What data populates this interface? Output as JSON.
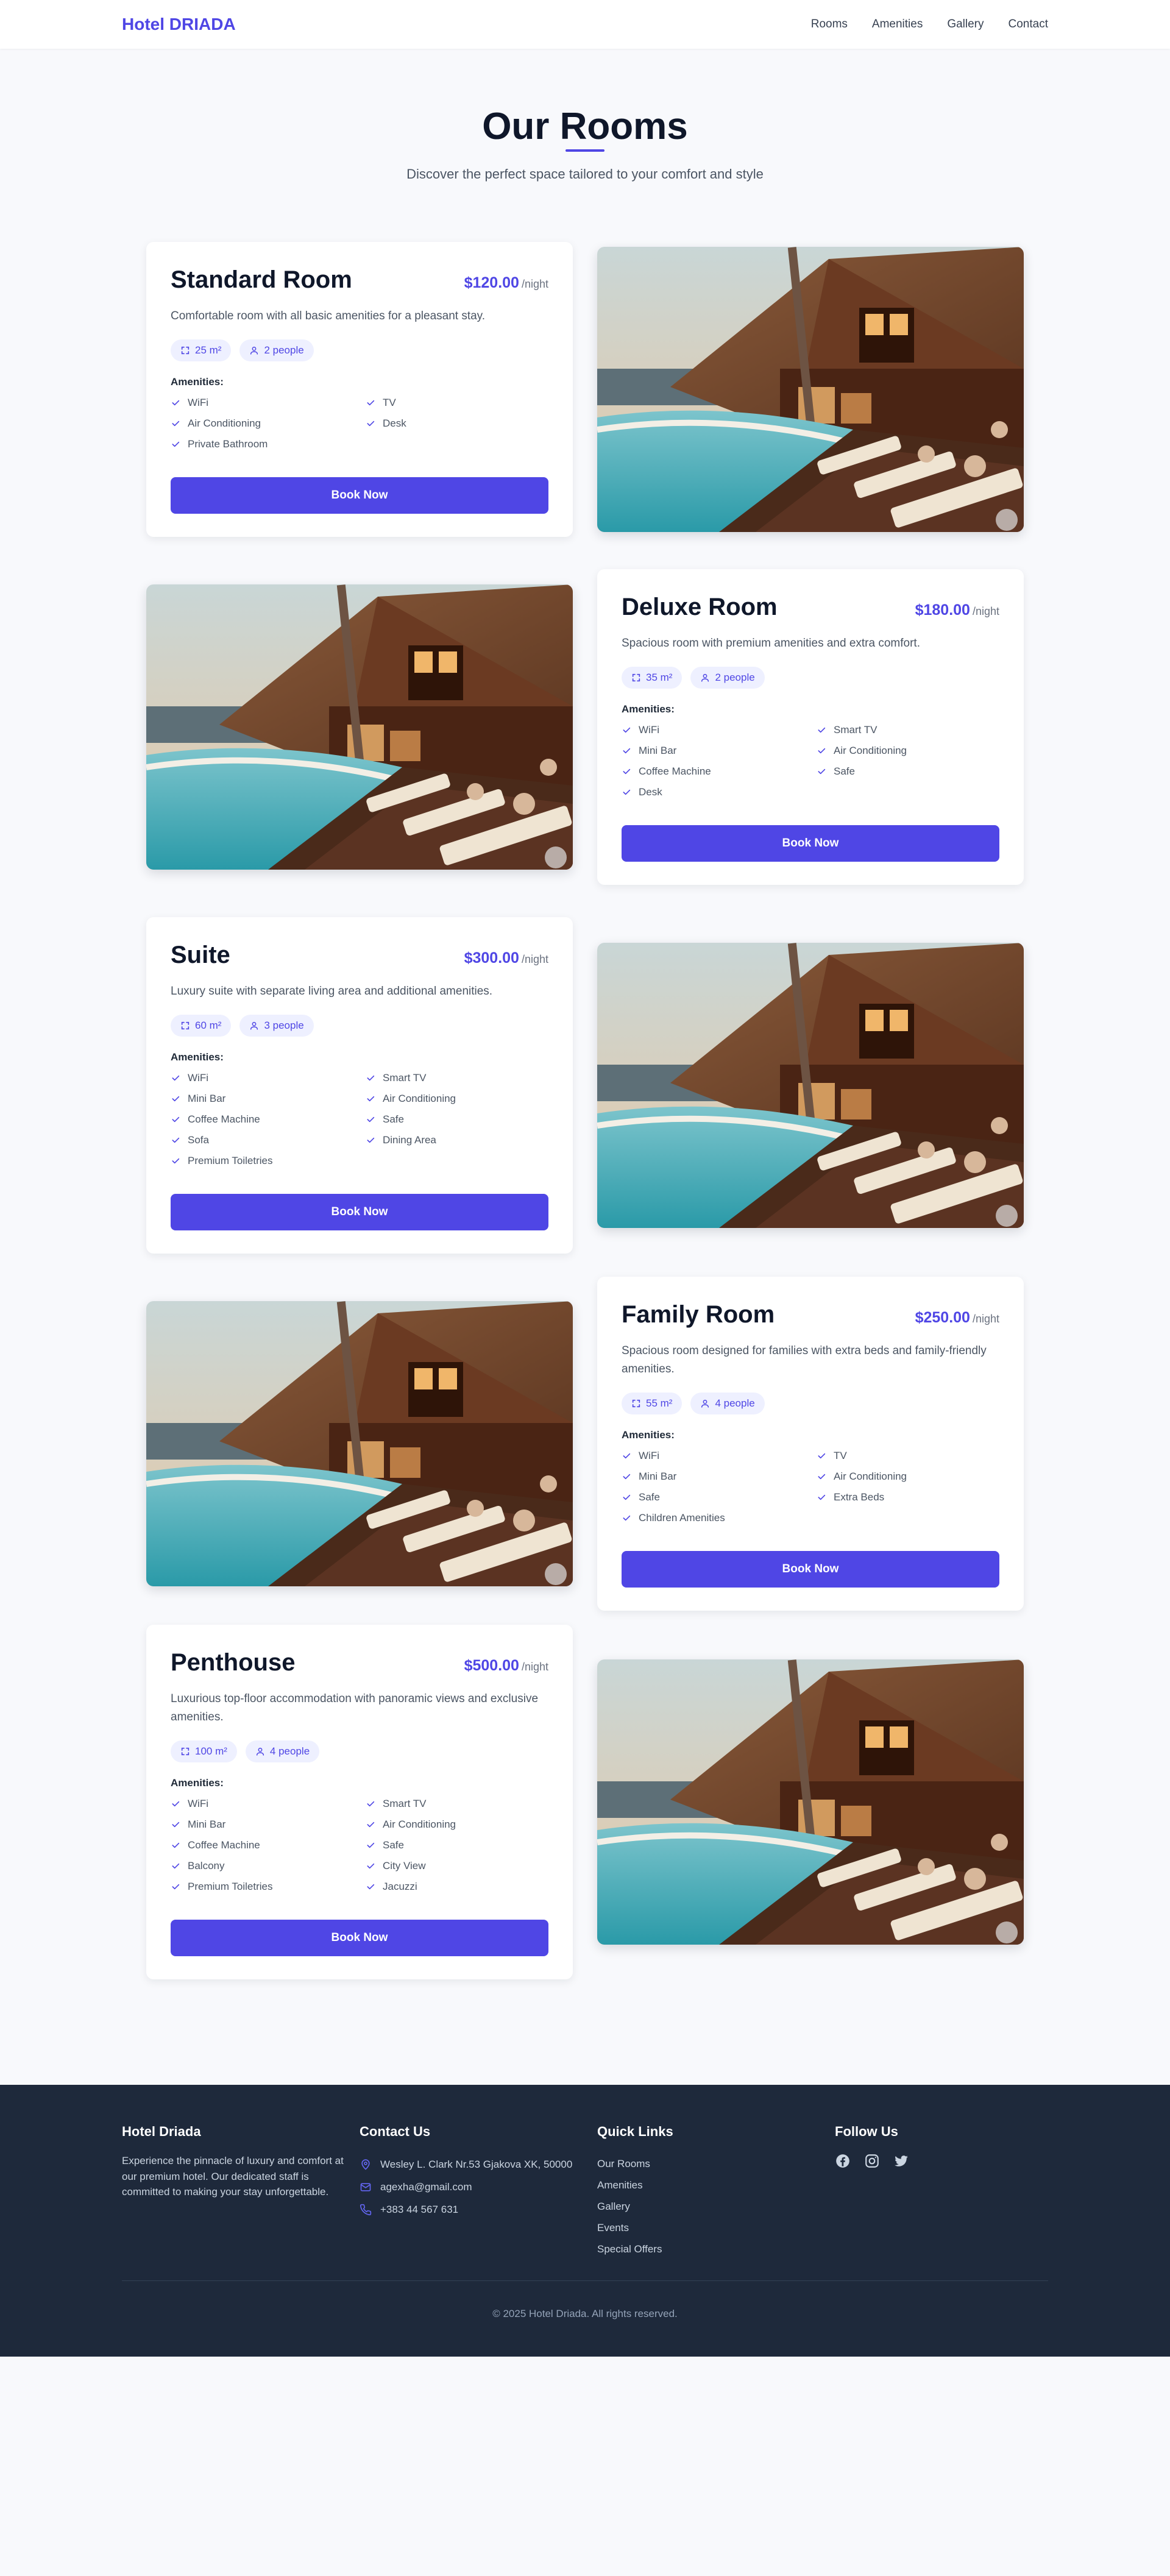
{
  "nav": {
    "brand": "Hotel DRIADA",
    "links": [
      "Rooms",
      "Amenities",
      "Gallery",
      "Contact"
    ]
  },
  "header": {
    "title": "Our Rooms",
    "subtitle": "Discover the perfect space tailored to your comfort and style"
  },
  "labels": {
    "per_night": "/night",
    "amenities": "Amenities:",
    "book_now": "Book Now"
  },
  "rooms": [
    {
      "name": "Standard Room",
      "price": "$120.00",
      "description": "Comfortable room with all basic amenities for a pleasant stay.",
      "size": "25 m²",
      "capacity": "2 people",
      "amenities": [
        "WiFi",
        "TV",
        "Air Conditioning",
        "Desk",
        "Private Bathroom"
      ]
    },
    {
      "name": "Deluxe Room",
      "price": "$180.00",
      "description": "Spacious room with premium amenities and extra comfort.",
      "size": "35 m²",
      "capacity": "2 people",
      "amenities": [
        "WiFi",
        "Smart TV",
        "Mini Bar",
        "Air Conditioning",
        "Coffee Machine",
        "Safe",
        "Desk"
      ]
    },
    {
      "name": "Suite",
      "price": "$300.00",
      "description": "Luxury suite with separate living area and additional amenities.",
      "size": "60 m²",
      "capacity": "3 people",
      "amenities": [
        "WiFi",
        "Smart TV",
        "Mini Bar",
        "Air Conditioning",
        "Coffee Machine",
        "Safe",
        "Sofa",
        "Dining Area",
        "Premium Toiletries"
      ]
    },
    {
      "name": "Family Room",
      "price": "$250.00",
      "description": "Spacious room designed for families with extra beds and family-friendly amenities.",
      "size": "55 m²",
      "capacity": "4 people",
      "amenities": [
        "WiFi",
        "TV",
        "Mini Bar",
        "Air Conditioning",
        "Safe",
        "Extra Beds",
        "Children Amenities"
      ]
    },
    {
      "name": "Penthouse",
      "price": "$500.00",
      "description": "Luxurious top-floor accommodation with panoramic views and exclusive amenities.",
      "size": "100 m²",
      "capacity": "4 people",
      "amenities": [
        "WiFi",
        "Smart TV",
        "Mini Bar",
        "Air Conditioning",
        "Coffee Machine",
        "Safe",
        "Balcony",
        "City View",
        "Premium Toiletries",
        "Jacuzzi"
      ]
    }
  ],
  "footer": {
    "about_title": "Hotel Driada",
    "about_text": "Experience the pinnacle of luxury and comfort at our premium hotel. Our dedicated staff is committed to making your stay unforgettable.",
    "contact_title": "Contact Us",
    "address": "Wesley L. Clark Nr.53 Gjakova XK, 50000",
    "email": "agexha@gmail.com",
    "phone": "+383 44 567 631",
    "links_title": "Quick Links",
    "links": [
      "Our Rooms",
      "Amenities",
      "Gallery",
      "Events",
      "Special Offers"
    ],
    "follow_title": "Follow Us",
    "socials": [
      "facebook-icon",
      "instagram-icon",
      "twitter-icon"
    ],
    "copyright": "© 2025 Hotel Driada. All rights reserved."
  },
  "colors": {
    "accent": "#4f46e5",
    "footer_bg": "#1e293b",
    "page_bg": "#f8f9fc"
  }
}
